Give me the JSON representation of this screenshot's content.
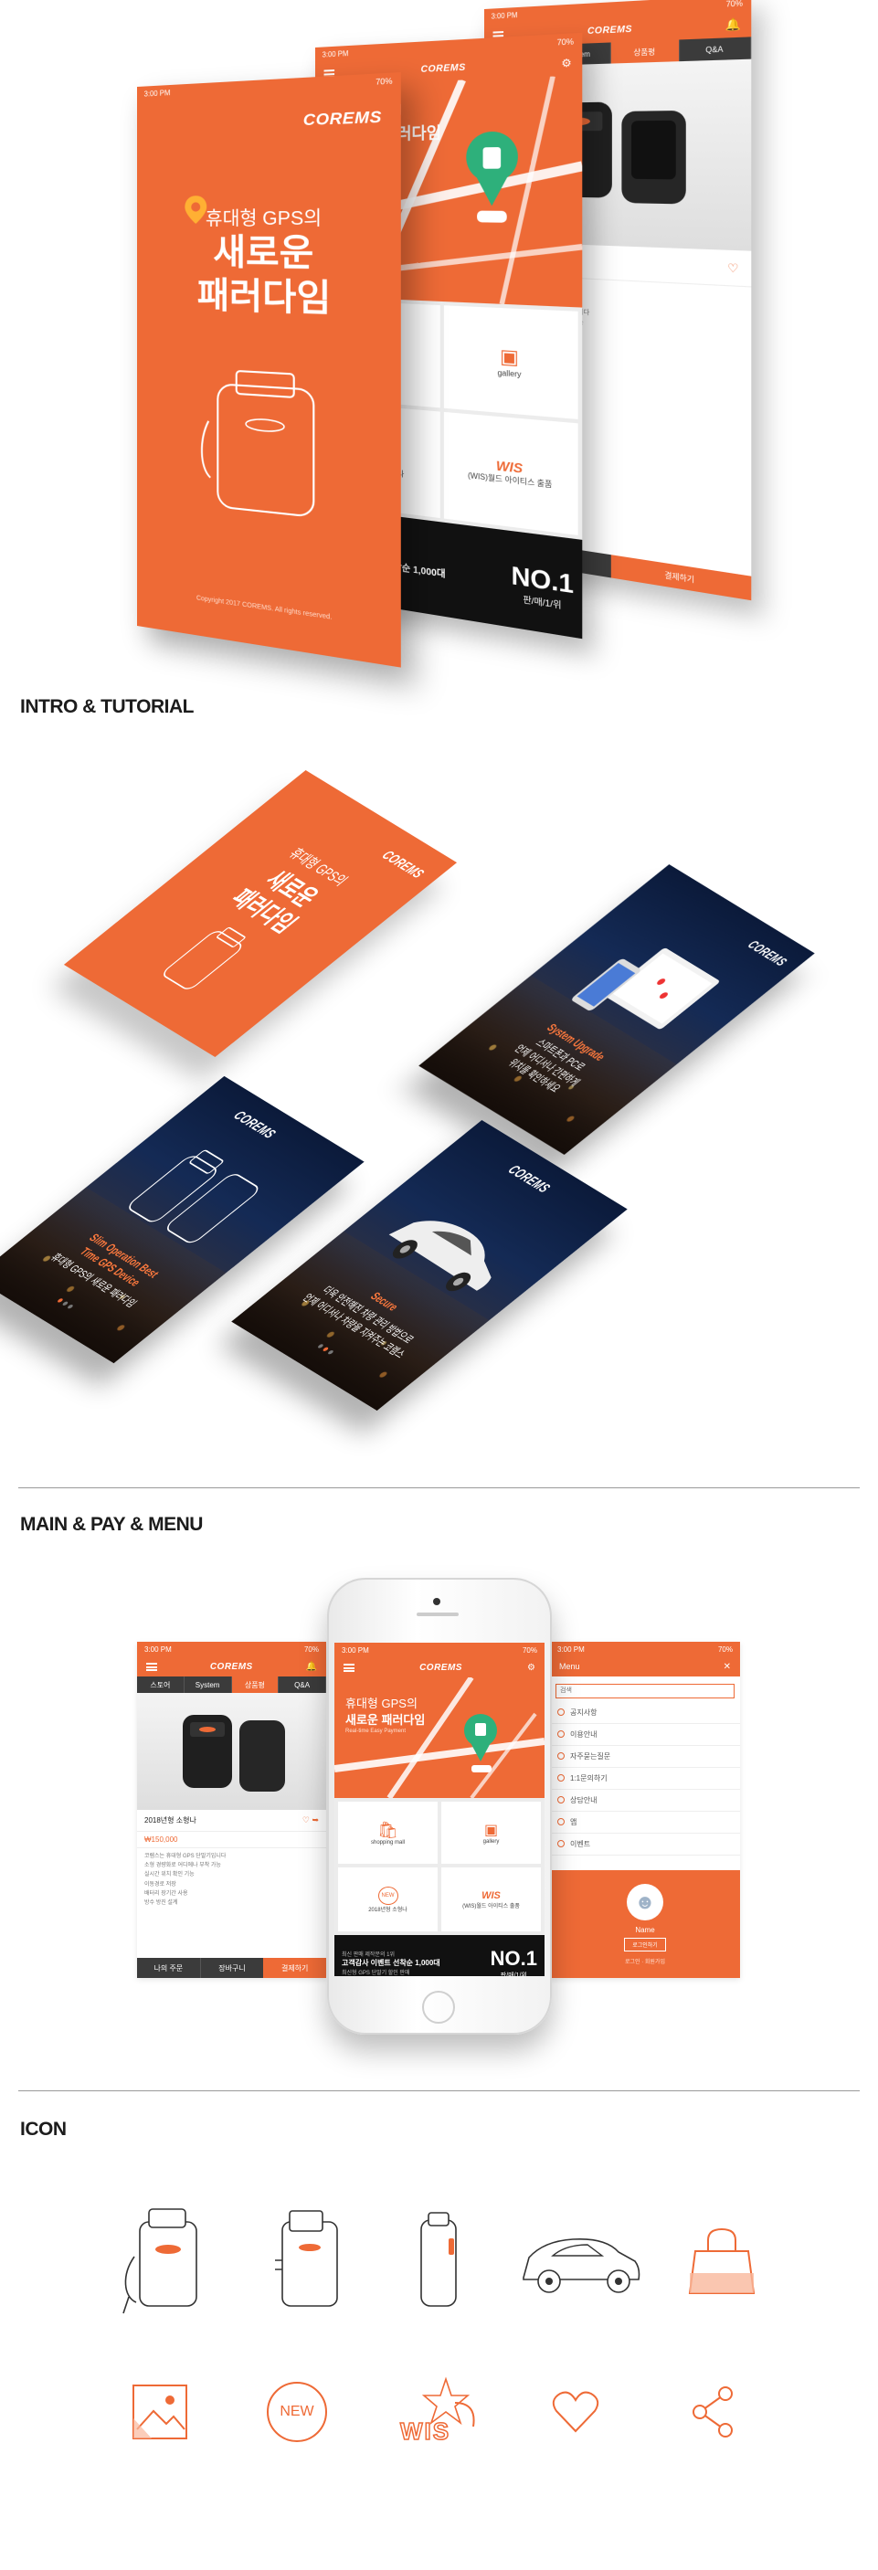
{
  "brand": {
    "logo": "COREMS",
    "logo_sub": "코렘스",
    "accent": "#ee6a36"
  },
  "status_bar": {
    "time": "3:00 PM",
    "battery": "70%"
  },
  "splash": {
    "line1": "휴대형 GPS의",
    "line2": "새로운",
    "line3": "패러다임",
    "copyright": "Copyright 2017 COREMS. All rights reserved."
  },
  "sections": {
    "intro": "INTRO & TUTORIAL",
    "main": "MAIN & PAY & MENU",
    "icon": "ICON"
  },
  "tutorial": [
    {
      "en_1": "Slim Operation Best",
      "en_2": "Time GPS Device",
      "ko": "휴대형 GPS의 새로운 패러다임"
    },
    {
      "en_1": "Secure",
      "ko_1": "더욱 안전해진 차량 관리 방법으로",
      "ko_2": "언제 어디서나 차량을 지켜주는 코렘스"
    },
    {
      "en_1": "System Upgrade",
      "ko_1": "스마트폰과 PC로",
      "ko_2": "언제 어디서나 간편하게",
      "ko_3": "위치를 확인하세요"
    }
  ],
  "product_screen": {
    "tabs": [
      "스토어",
      "System",
      "상품평",
      "Q&A"
    ],
    "title": "2018년형 소형나",
    "price": "₩150,000",
    "buttons": [
      "나의 주문",
      "장바구니",
      "결제하기"
    ],
    "desc_lines": [
      "코렘스는 휴대형 GPS 단말기입니다",
      "소형 경량화로 어디에나 부착 가능",
      "실시간 위치 확인 기능",
      "이동경로 저장",
      "배터리 장기간 사용",
      "방수 방진 설계"
    ],
    "more": "더보기"
  },
  "main_screen": {
    "hero_small": "휴대형 GPS의",
    "hero_big": "새로운 패러다임",
    "hero_tag": "Real-time Easy Payment",
    "tiles": [
      {
        "label": "shopping mall",
        "icon": "bag-icon"
      },
      {
        "label": "gallery",
        "icon": "picture-icon"
      },
      {
        "label": "2018년형 소형나",
        "icon": "new-icon"
      },
      {
        "label": "(WIS)월드 아이티스 출품",
        "icon": "wis-icon"
      }
    ],
    "banner_small": "최신 판매 제작문의 1위",
    "banner_title": "고객감사 이벤트 선착순 1,000대",
    "banner_sub": "최신형 GPS 단말기 할인 판매",
    "no1": "NO.1",
    "no1_sub": "판/매/1/위"
  },
  "menu_screen": {
    "title": "Menu",
    "search_placeholder": "검색",
    "items": [
      "공지사항",
      "이용안내",
      "자주묻는질문",
      "1:1문의하기",
      "상담안내",
      "앱",
      "이벤트"
    ],
    "user_name": "Name",
    "login_button": "로그인하기",
    "footer": "로그인 · 회원가입"
  },
  "icons": [
    "gps-device-front-icon",
    "gps-device-back-icon",
    "gps-device-side-icon",
    "car-icon",
    "shopping-bag-icon",
    "gallery-icon",
    "new-badge-icon",
    "wis-icon",
    "heart-icon",
    "share-icon"
  ],
  "icon_new_label": "NEW",
  "icon_wis_label": "WIS"
}
